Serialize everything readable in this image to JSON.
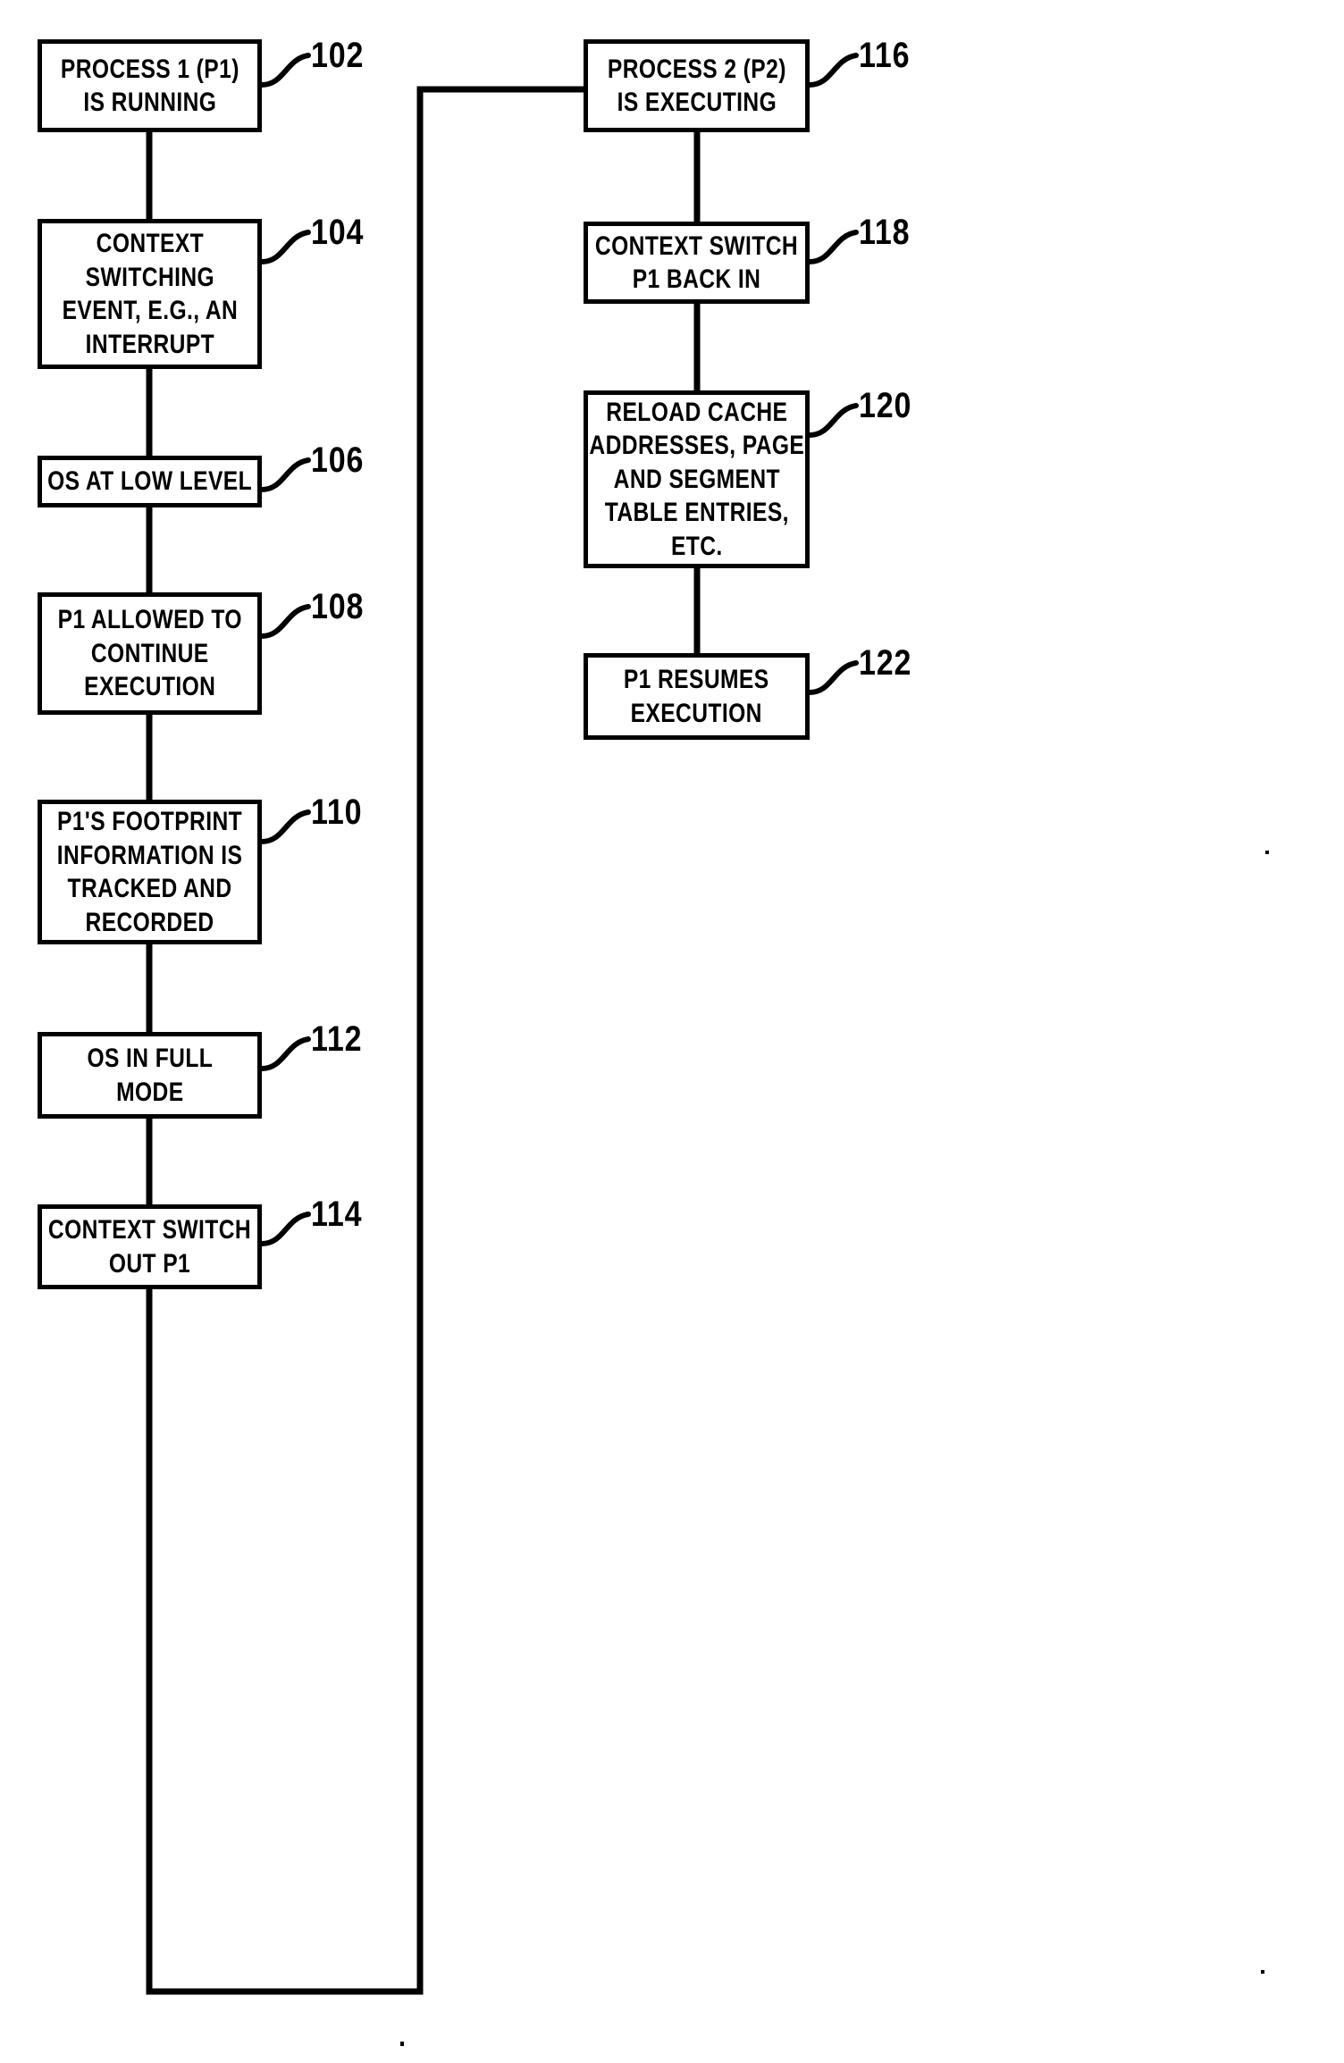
{
  "figure": {
    "kind": "patent-flowchart",
    "background_color": "#ffffff",
    "line_color": "#000000",
    "text_color": "#000000"
  },
  "nodes": [
    {
      "id": "n102",
      "ref": "102",
      "text": "PROCESS 1 (P1)\nIS RUNNING",
      "column": "left"
    },
    {
      "id": "n104",
      "ref": "104",
      "text": "CONTEXT\nSWITCHING\nEVENT, E.G., AN\nINTERRUPT",
      "column": "left"
    },
    {
      "id": "n106",
      "ref": "106",
      "text": "OS AT LOW LEVEL",
      "column": "left"
    },
    {
      "id": "n108",
      "ref": "108",
      "text": "P1 ALLOWED TO\nCONTINUE\nEXECUTION",
      "column": "left"
    },
    {
      "id": "n110",
      "ref": "110",
      "text": "P1'S FOOTPRINT\nINFORMATION IS\nTRACKED AND\nRECORDED",
      "column": "left"
    },
    {
      "id": "n112",
      "ref": "112",
      "text": "OS IN FULL\nMODE",
      "column": "left"
    },
    {
      "id": "n114",
      "ref": "114",
      "text": "CONTEXT SWITCH\nOUT P1",
      "column": "left"
    },
    {
      "id": "n116",
      "ref": "116",
      "text": "PROCESS 2 (P2)\nIS EXECUTING",
      "column": "right"
    },
    {
      "id": "n118",
      "ref": "118",
      "text": "CONTEXT SWITCH\nP1 BACK IN",
      "column": "right"
    },
    {
      "id": "n120",
      "ref": "120",
      "text": "RELOAD CACHE\nADDRESSES, PAGE\nAND SEGMENT\nTABLE ENTRIES,\nETC.",
      "column": "right"
    },
    {
      "id": "n122",
      "ref": "122",
      "text": "P1 RESUMES\nEXECUTION",
      "column": "right"
    }
  ],
  "flow_sequence": [
    "n102",
    "n104",
    "n106",
    "n108",
    "n110",
    "n112",
    "n114",
    "n116",
    "n118",
    "n120",
    "n122"
  ]
}
